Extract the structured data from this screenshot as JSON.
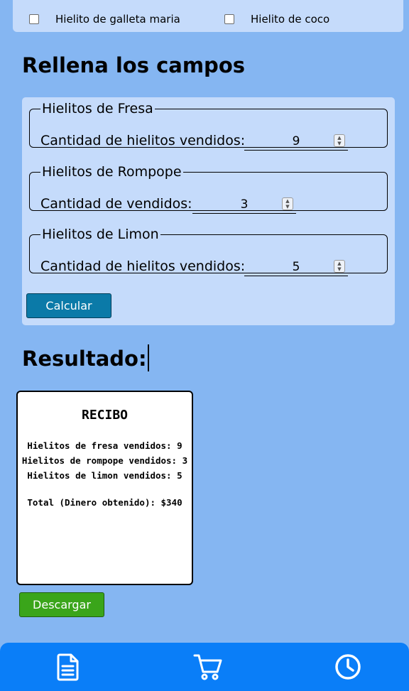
{
  "filters": {
    "checkboxes": [
      {
        "label": "Hielito de galleta maria",
        "checked": false
      },
      {
        "label": "Hielito de coco",
        "checked": false
      }
    ]
  },
  "form": {
    "title": "Rellena los campos",
    "groups": [
      {
        "legend": "Hielitos de Fresa",
        "label": "Cantidad de hielitos vendidos:",
        "value": "9"
      },
      {
        "legend": "Hielitos de Rompope",
        "label": "Cantidad de vendidos:",
        "value": "3"
      },
      {
        "legend": "Hielitos de Limon",
        "label": "Cantidad de hielitos vendidos:",
        "value": "5"
      }
    ],
    "calculate_label": "Calcular"
  },
  "result": {
    "title": "Resultado:",
    "receipt": {
      "heading": "RECIBO",
      "lines": [
        "Hielitos de fresa vendidos: 9",
        "Hielitos de rompope vendidos: 3",
        "Hielitos de limon vendidos: 5"
      ],
      "total": "Total (Dinero obtenido): $340"
    },
    "download_label": "Descargar"
  },
  "nav": {
    "items": [
      {
        "icon": "document-icon"
      },
      {
        "icon": "cart-icon"
      },
      {
        "icon": "clock-icon"
      }
    ]
  },
  "colors": {
    "background": "#85b6f2",
    "card": "#c5dbfb",
    "calculate_button": "#0b7aa8",
    "download_button": "#3aa51a",
    "nav_bar": "#0a7ef8"
  }
}
